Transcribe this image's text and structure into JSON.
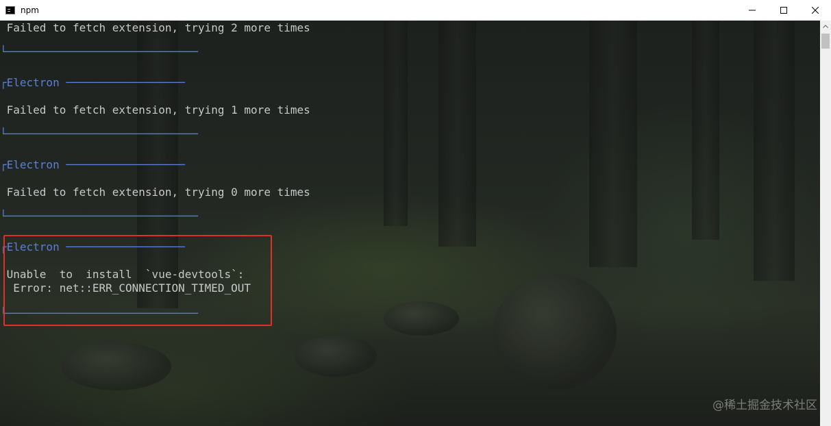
{
  "window": {
    "title": "npm",
    "minimize_label": "—",
    "maximize_label": "☐",
    "close_label": "✕"
  },
  "terminal": {
    "lines": [
      {
        "text": " Failed to fetch extension, trying 2 more times",
        "color": "normal"
      },
      {
        "text": "└─────────────────────────────",
        "color": "blue"
      },
      {
        "text": "┌Electron ──────────────────",
        "color": "blue"
      },
      {
        "text": " Failed to fetch extension, trying 1 more times",
        "color": "normal"
      },
      {
        "text": "└─────────────────────────────",
        "color": "blue"
      },
      {
        "text": "┌Electron ──────────────────",
        "color": "blue"
      },
      {
        "text": " Failed to fetch extension, trying 0 more times",
        "color": "normal"
      },
      {
        "text": "└─────────────────────────────",
        "color": "blue"
      },
      {
        "text": "┌Electron ──────────────────",
        "color": "blue"
      },
      {
        "text": " Unable  to  install  `vue-devtools`:",
        "color": "normal"
      },
      {
        "text": "  Error: net::ERR_CONNECTION_TIMED_OUT",
        "color": "normal"
      },
      {
        "text": "└─────────────────────────────",
        "color": "blue"
      }
    ]
  },
  "watermark": "@稀土掘金技术社区",
  "colors": {
    "text": "#c8c8c8",
    "accent_blue": "#5b7fd6",
    "highlight_border": "#e0302a",
    "titlebar_bg": "#ffffff"
  }
}
